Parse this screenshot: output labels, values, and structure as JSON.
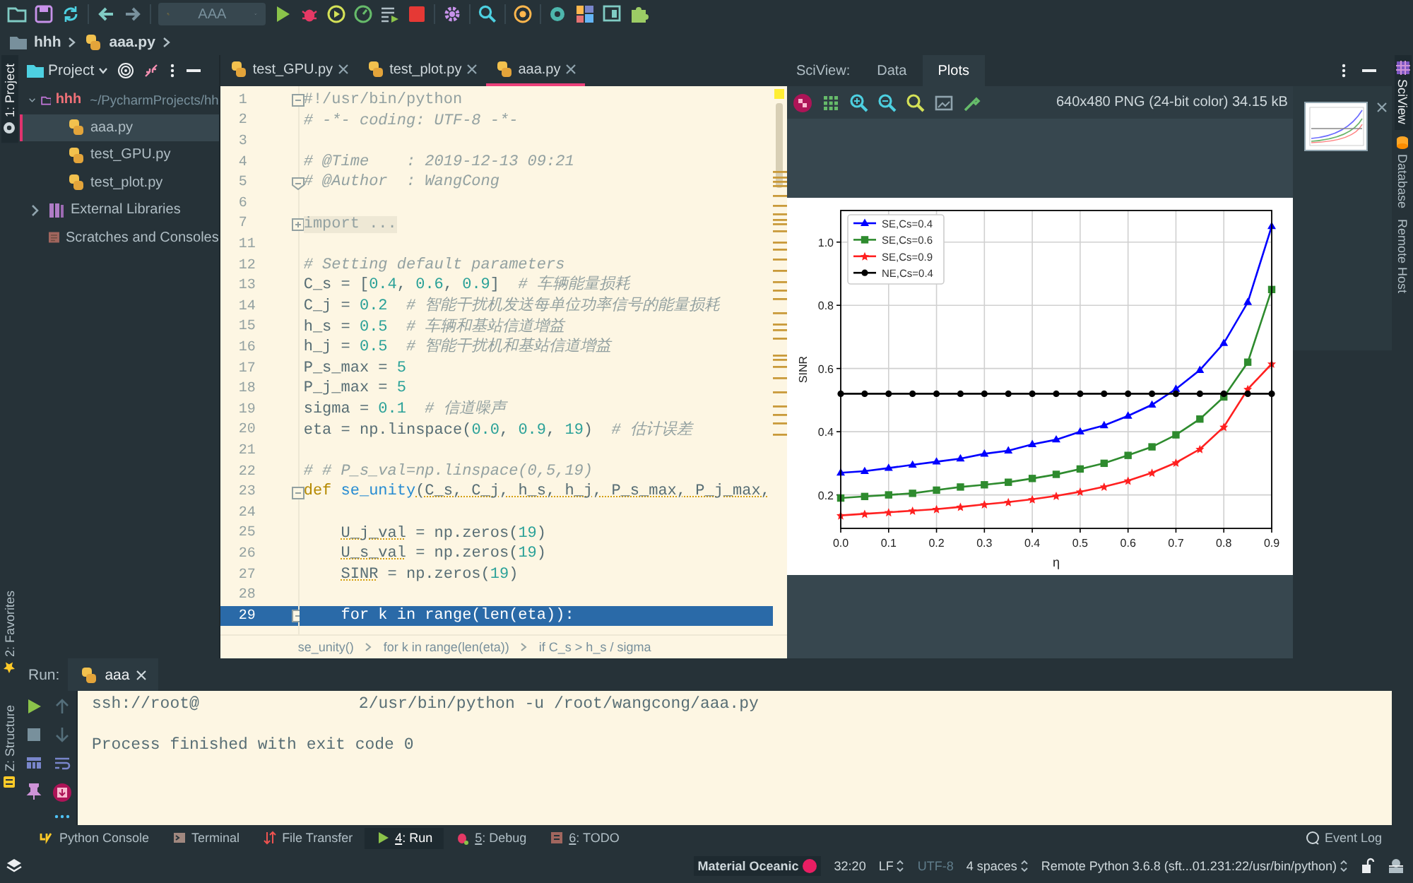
{
  "toolbar": {
    "run_config": "AAA"
  },
  "breadcrumb": [
    {
      "label": "hhh",
      "kind": "folder"
    },
    {
      "label": "aaa.py",
      "kind": "python"
    }
  ],
  "left_strip_top": [
    {
      "label": "1: Project",
      "selected": true
    }
  ],
  "left_strip_bottom": [
    {
      "label": "2: Favorites",
      "kind": "star",
      "selected": false
    },
    {
      "label": "Z: Structure",
      "kind": "structure",
      "selected": false
    }
  ],
  "project": {
    "title": "Project",
    "tree": [
      {
        "label": "hhh",
        "path": "~/PycharmProjects/hh",
        "kind": "folder",
        "expanded": true,
        "selected": false,
        "children": [
          {
            "label": "aaa.py",
            "kind": "python",
            "selected": true
          },
          {
            "label": "test_GPU.py",
            "kind": "python",
            "selected": false
          },
          {
            "label": "test_plot.py",
            "kind": "python",
            "selected": false
          }
        ]
      },
      {
        "label": "External Libraries",
        "kind": "library",
        "expanded": false,
        "selected": false
      },
      {
        "label": "Scratches and Consoles",
        "kind": "scratch",
        "selected": false
      }
    ]
  },
  "editor": {
    "tabs": [
      {
        "label": "test_GPU.py",
        "selected": false
      },
      {
        "label": "test_plot.py",
        "selected": false
      },
      {
        "label": "aaa.py",
        "selected": true
      }
    ],
    "lines": [
      {
        "number": "1",
        "kind": "fold_start",
        "selected": false,
        "code": [
          {
            "kind": "shebang",
            "text": "#!/usr/bin/python"
          }
        ]
      },
      {
        "number": "2",
        "kind": "plain",
        "selected": false,
        "code": [
          {
            "kind": "comment",
            "text": "# -*- coding: UTF-8 -*-"
          }
        ]
      },
      {
        "number": "3",
        "kind": "plain",
        "selected": false
      },
      {
        "number": "4",
        "kind": "plain",
        "selected": false,
        "code": [
          {
            "kind": "comment",
            "text": "# @Time    : 2019-12-13 09:21"
          }
        ]
      },
      {
        "number": "5",
        "kind": "fold_end",
        "selected": false,
        "code": [
          {
            "kind": "comment",
            "text": "# @Author  : WangCong"
          }
        ]
      },
      {
        "number": "6",
        "kind": "plain",
        "selected": false
      },
      {
        "number": "7",
        "kind": "fold_collapsed",
        "selected": false,
        "code": [
          {
            "kind": "folded",
            "text": "import ..."
          }
        ]
      },
      {
        "number": "11",
        "kind": "plain",
        "selected": false
      },
      {
        "number": "12",
        "kind": "plain",
        "selected": false,
        "code": [
          {
            "kind": "comment",
            "text": "# Setting default parameters"
          }
        ]
      },
      {
        "number": "13",
        "kind": "plain",
        "selected": false,
        "code": [
          {
            "kind": "plain",
            "text": "C_s = ["
          },
          {
            "kind": "num",
            "text": "0.4"
          },
          {
            "kind": "plain",
            "text": ", "
          },
          {
            "kind": "num",
            "text": "0.6"
          },
          {
            "kind": "plain",
            "text": ", "
          },
          {
            "kind": "num",
            "text": "0.9"
          },
          {
            "kind": "plain",
            "text": "]"
          },
          {
            "kind": "comment",
            "text": "  # 车辆能量损耗"
          }
        ]
      },
      {
        "number": "14",
        "kind": "plain",
        "selected": false,
        "code": [
          {
            "kind": "plain",
            "text": "C_j = "
          },
          {
            "kind": "num",
            "text": "0.2"
          },
          {
            "kind": "comment",
            "text": "  # 智能干扰机发送每单位功率信号的能量损耗"
          }
        ]
      },
      {
        "number": "15",
        "kind": "plain",
        "selected": false,
        "code": [
          {
            "kind": "plain",
            "text": "h_s = "
          },
          {
            "kind": "num",
            "text": "0.5"
          },
          {
            "kind": "comment",
            "text": "  # 车辆和基站信道增益"
          }
        ]
      },
      {
        "number": "16",
        "kind": "plain",
        "selected": false,
        "code": [
          {
            "kind": "plain",
            "text": "h_j = "
          },
          {
            "kind": "num",
            "text": "0.5"
          },
          {
            "kind": "comment",
            "text": "  # 智能干扰机和基站信道增益"
          }
        ]
      },
      {
        "number": "17",
        "kind": "plain",
        "selected": false,
        "code": [
          {
            "kind": "plain",
            "text": "P_s_max = "
          },
          {
            "kind": "num",
            "text": "5"
          }
        ]
      },
      {
        "number": "18",
        "kind": "plain",
        "selected": false,
        "code": [
          {
            "kind": "plain",
            "text": "P_j_max = "
          },
          {
            "kind": "num",
            "text": "5"
          }
        ]
      },
      {
        "number": "19",
        "kind": "plain",
        "selected": false,
        "code": [
          {
            "kind": "plain",
            "text": "sigma = "
          },
          {
            "kind": "num",
            "text": "0.1"
          },
          {
            "kind": "comment",
            "text": "  # 信道噪声"
          }
        ]
      },
      {
        "number": "20",
        "kind": "plain",
        "selected": false,
        "code": [
          {
            "kind": "plain",
            "text": "eta = np.linspace("
          },
          {
            "kind": "num",
            "text": "0.0"
          },
          {
            "kind": "plain",
            "text": ", "
          },
          {
            "kind": "num",
            "text": "0.9"
          },
          {
            "kind": "plain",
            "text": ", "
          },
          {
            "kind": "num",
            "text": "19"
          },
          {
            "kind": "plain",
            "text": ")"
          },
          {
            "kind": "comment",
            "text": "  # 估计误差"
          }
        ]
      },
      {
        "number": "21",
        "kind": "plain",
        "selected": false
      },
      {
        "number": "22",
        "kind": "plain",
        "selected": false,
        "code": [
          {
            "kind": "comment",
            "text": "# # P_s_val=np.linspace(0,5,19)"
          }
        ]
      },
      {
        "number": "23",
        "kind": "fold_start",
        "selected": false,
        "code": [
          {
            "kind": "keyword",
            "text": "def "
          },
          {
            "kind": "function",
            "text": "se_unity"
          },
          {
            "kind": "warn",
            "text": "(C_s, C_j, h_s, h_j, P_s_max, P_j_max,"
          }
        ]
      },
      {
        "number": "24",
        "kind": "plain",
        "selected": false
      },
      {
        "number": "25",
        "kind": "plain",
        "selected": false,
        "code": [
          {
            "kind": "warn",
            "text": "    U_j_val"
          },
          {
            "kind": "plain",
            "text": " = np.zeros("
          },
          {
            "kind": "num",
            "text": "19"
          },
          {
            "kind": "plain",
            "text": ")"
          }
        ]
      },
      {
        "number": "26",
        "kind": "plain",
        "selected": false,
        "code": [
          {
            "kind": "warn",
            "text": "    U_s_val"
          },
          {
            "kind": "plain",
            "text": " = np.zeros("
          },
          {
            "kind": "num",
            "text": "19"
          },
          {
            "kind": "plain",
            "text": ")"
          }
        ]
      },
      {
        "number": "27",
        "kind": "plain",
        "selected": false,
        "code": [
          {
            "kind": "warn",
            "text": "    SINR"
          },
          {
            "kind": "plain",
            "text": " = np.zeros("
          },
          {
            "kind": "num",
            "text": "19"
          },
          {
            "kind": "plain",
            "text": ")"
          }
        ]
      },
      {
        "number": "28",
        "kind": "plain",
        "selected": false
      },
      {
        "number": "29",
        "kind": "fold_start",
        "selected": true,
        "code": [
          {
            "kind": "plain",
            "text": "    for k in range(len(eta)):"
          }
        ]
      }
    ],
    "breadcrumb": [
      "se_unity()",
      "for k in range(len(eta))",
      "if C_s > h_s / sigma"
    ]
  },
  "sciview": {
    "label": "SciView:",
    "tabs": [
      {
        "label": "Data",
        "selected": false
      },
      {
        "label": "Plots",
        "selected": true
      }
    ],
    "image_info": "640x480 PNG (24-bit color) 34.15 kB",
    "chart_data": {
      "type": "line",
      "xlabel": "η",
      "ylabel": "SINR",
      "grid": true,
      "legend": true,
      "x": [
        0,
        0.05,
        0.1,
        0.15,
        0.2,
        0.25,
        0.3,
        0.35,
        0.4,
        0.45,
        0.5,
        0.55,
        0.6,
        0.65,
        0.7,
        0.75,
        0.8,
        0.85,
        0.9
      ],
      "series": [
        {
          "name": "SE,Cs=0.4",
          "color": "#0000ff",
          "marker": "triangle",
          "values": [
            0.27,
            0.275,
            0.285,
            0.295,
            0.305,
            0.315,
            0.33,
            0.34,
            0.36,
            0.375,
            0.4,
            0.42,
            0.45,
            0.485,
            0.535,
            0.595,
            0.68,
            0.81,
            1.05
          ]
        },
        {
          "name": "SE,Cs=0.6",
          "color": "#2e8b2e",
          "marker": "square",
          "values": [
            0.19,
            0.195,
            0.2,
            0.205,
            0.215,
            0.225,
            0.232,
            0.24,
            0.252,
            0.265,
            0.282,
            0.3,
            0.325,
            0.352,
            0.39,
            0.44,
            0.51,
            0.62,
            0.85
          ]
        },
        {
          "name": "SE,Cs=0.9",
          "color": "#ff2020",
          "marker": "star",
          "values": [
            0.135,
            0.14,
            0.145,
            0.15,
            0.155,
            0.162,
            0.17,
            0.177,
            0.186,
            0.197,
            0.21,
            0.226,
            0.245,
            0.27,
            0.302,
            0.345,
            0.415,
            0.535,
            0.615
          ]
        },
        {
          "name": "NE,Cs=0.4",
          "color": "#000000",
          "marker": "circle",
          "values": [
            0.52,
            0.52,
            0.52,
            0.52,
            0.52,
            0.52,
            0.52,
            0.52,
            0.52,
            0.52,
            0.52,
            0.52,
            0.52,
            0.52,
            0.52,
            0.52,
            0.52,
            0.52,
            0.52
          ]
        }
      ],
      "xlim": [
        0,
        0.9
      ],
      "ylim": [
        0.094,
        1.1
      ],
      "xticks": [
        {
          "value": 0,
          "label": "0.0"
        },
        {
          "value": 0.1,
          "label": "0.1"
        },
        {
          "value": 0.2,
          "label": "0.2"
        },
        {
          "value": 0.3,
          "label": "0.3"
        },
        {
          "value": 0.4,
          "label": "0.4"
        },
        {
          "value": 0.5,
          "label": "0.5"
        },
        {
          "value": 0.6,
          "label": "0.6"
        },
        {
          "value": 0.7,
          "label": "0.7"
        },
        {
          "value": 0.8,
          "label": "0.8"
        },
        {
          "value": 0.9,
          "label": "0.9"
        }
      ],
      "yticks": [
        {
          "value": 0.2,
          "label": "0.2"
        },
        {
          "value": 0.4,
          "label": "0.4"
        },
        {
          "value": 0.6,
          "label": "0.6"
        },
        {
          "value": 0.8,
          "label": "0.8"
        },
        {
          "value": 1.0,
          "label": "1.0"
        }
      ]
    }
  },
  "right_strip": [
    {
      "label": "SciView",
      "kind": "grid",
      "selected": true
    },
    {
      "label": "Database",
      "kind": "database",
      "selected": false
    },
    {
      "label": "Remote Host",
      "kind": "text",
      "selected": false
    }
  ],
  "run": {
    "label": "Run:",
    "tab": "aaa",
    "command_start": "ssh://root@",
    "command_rest": "2/usr/bin/python -u /root/wangcong/aaa.py",
    "output": "Process finished with exit code 0"
  },
  "tool_tabs": [
    {
      "label": "Python Console",
      "kind": "python",
      "selected": false
    },
    {
      "label": "Terminal",
      "kind": "terminal",
      "selected": false
    },
    {
      "label": "File Transfer",
      "kind": "transfer",
      "selected": false
    },
    {
      "label": "4: Run",
      "kind": "run",
      "selected": true
    },
    {
      "label": "5: Debug",
      "kind": "debug",
      "selected": false
    },
    {
      "label": "6: TODO",
      "kind": "todo",
      "selected": false
    }
  ],
  "event_log": "Event Log",
  "status": {
    "theme": "Material Oceanic",
    "position": "32:20",
    "line_separator": "LF",
    "encoding": "UTF-8",
    "indent": "4 spaces",
    "interpreter": "Remote Python 3.6.8 (sft...01.231:22/usr/bin/python)"
  }
}
